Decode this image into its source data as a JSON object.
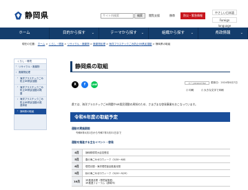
{
  "header": {
    "logo_text": "静岡県",
    "search_placeholder": "サイト内検索",
    "search_button": "検索",
    "link_a": "閲覧支援",
    "link_b": "携帯",
    "disaster_button": "防災・緊急情報",
    "lang_links": [
      "やさしい日本語",
      "Foreign language"
    ]
  },
  "nav": {
    "items": [
      "ホーム",
      "目的から探す",
      "テーマから探す",
      "組織から探す",
      "県政情報"
    ]
  },
  "breadcrumb": {
    "prefix": "現在の位置：",
    "items": [
      "ホーム",
      "くらし・環境",
      "リサイクル・廃棄物",
      "廃棄物処理",
      "海洋プラスチックごみ防止6R県民運動"
    ],
    "current": "静岡県の取組"
  },
  "sidebar": {
    "heading": "くらし・環境",
    "items": [
      {
        "label": "リサイクル・廃棄物",
        "sub": false,
        "active": false
      },
      {
        "label": "廃棄物処理",
        "sub": false,
        "active": false
      },
      {
        "label": "海洋プラスチックごみ防止6R県民運動",
        "sub": true,
        "active": false
      },
      {
        "label": "海洋プラスチックごみ防止6R県民運動の概要",
        "sub": true,
        "active": false
      },
      {
        "label": "海洋プラスチックごみ防止6R県民運動の推進体制",
        "sub": true,
        "active": false
      },
      {
        "label": "静岡県の取組",
        "sub": true,
        "active": true
      }
    ]
  },
  "main": {
    "title": "静岡県の取組",
    "social": {
      "x": "X",
      "fb": "f",
      "ln": "LINE"
    },
    "page_id": "ページID1047762",
    "updated": "更新日：2024年8月7日",
    "print": "印刷",
    "bigtext": "大きな文字で印刷",
    "intro": "県では、海洋プラスチックごみ問題や6R県民運動の周知のため、さまざまな啓発事業をおこなっています。",
    "section_title": "令和6年度の取組予定",
    "period_heading": "運動の実施期間",
    "period_text": "令和6年4月1日から令和7年3月31日まで",
    "events_heading": "運動を推進する主なイベント・啓発",
    "table": [
      {
        "month": "4月",
        "events": [
          "静岡県環境大臣賞受賞"
        ],
        "tall": false
      },
      {
        "month": "5月",
        "events": [
          "春の海ごみゼロウィーク（5/30～6/8）"
        ],
        "tall": false
      },
      {
        "month": "6月",
        "events": [
          "環境月間・海洋環境保全推進月間"
        ],
        "tall": false
      },
      {
        "month": "9月",
        "events": [
          "秋の海ごみゼロウィーク（9/20～9/29）"
        ],
        "tall": false
      },
      {
        "month": "10月",
        "events": [
          "3R推進月間（環境省推進）",
          "3R推進フォーラム（静岡市）"
        ],
        "tall": true
      }
    ]
  },
  "colors": {
    "nav_bg": "#143d6c",
    "accent": "#1a4e9a",
    "disaster": "#c8161d"
  }
}
